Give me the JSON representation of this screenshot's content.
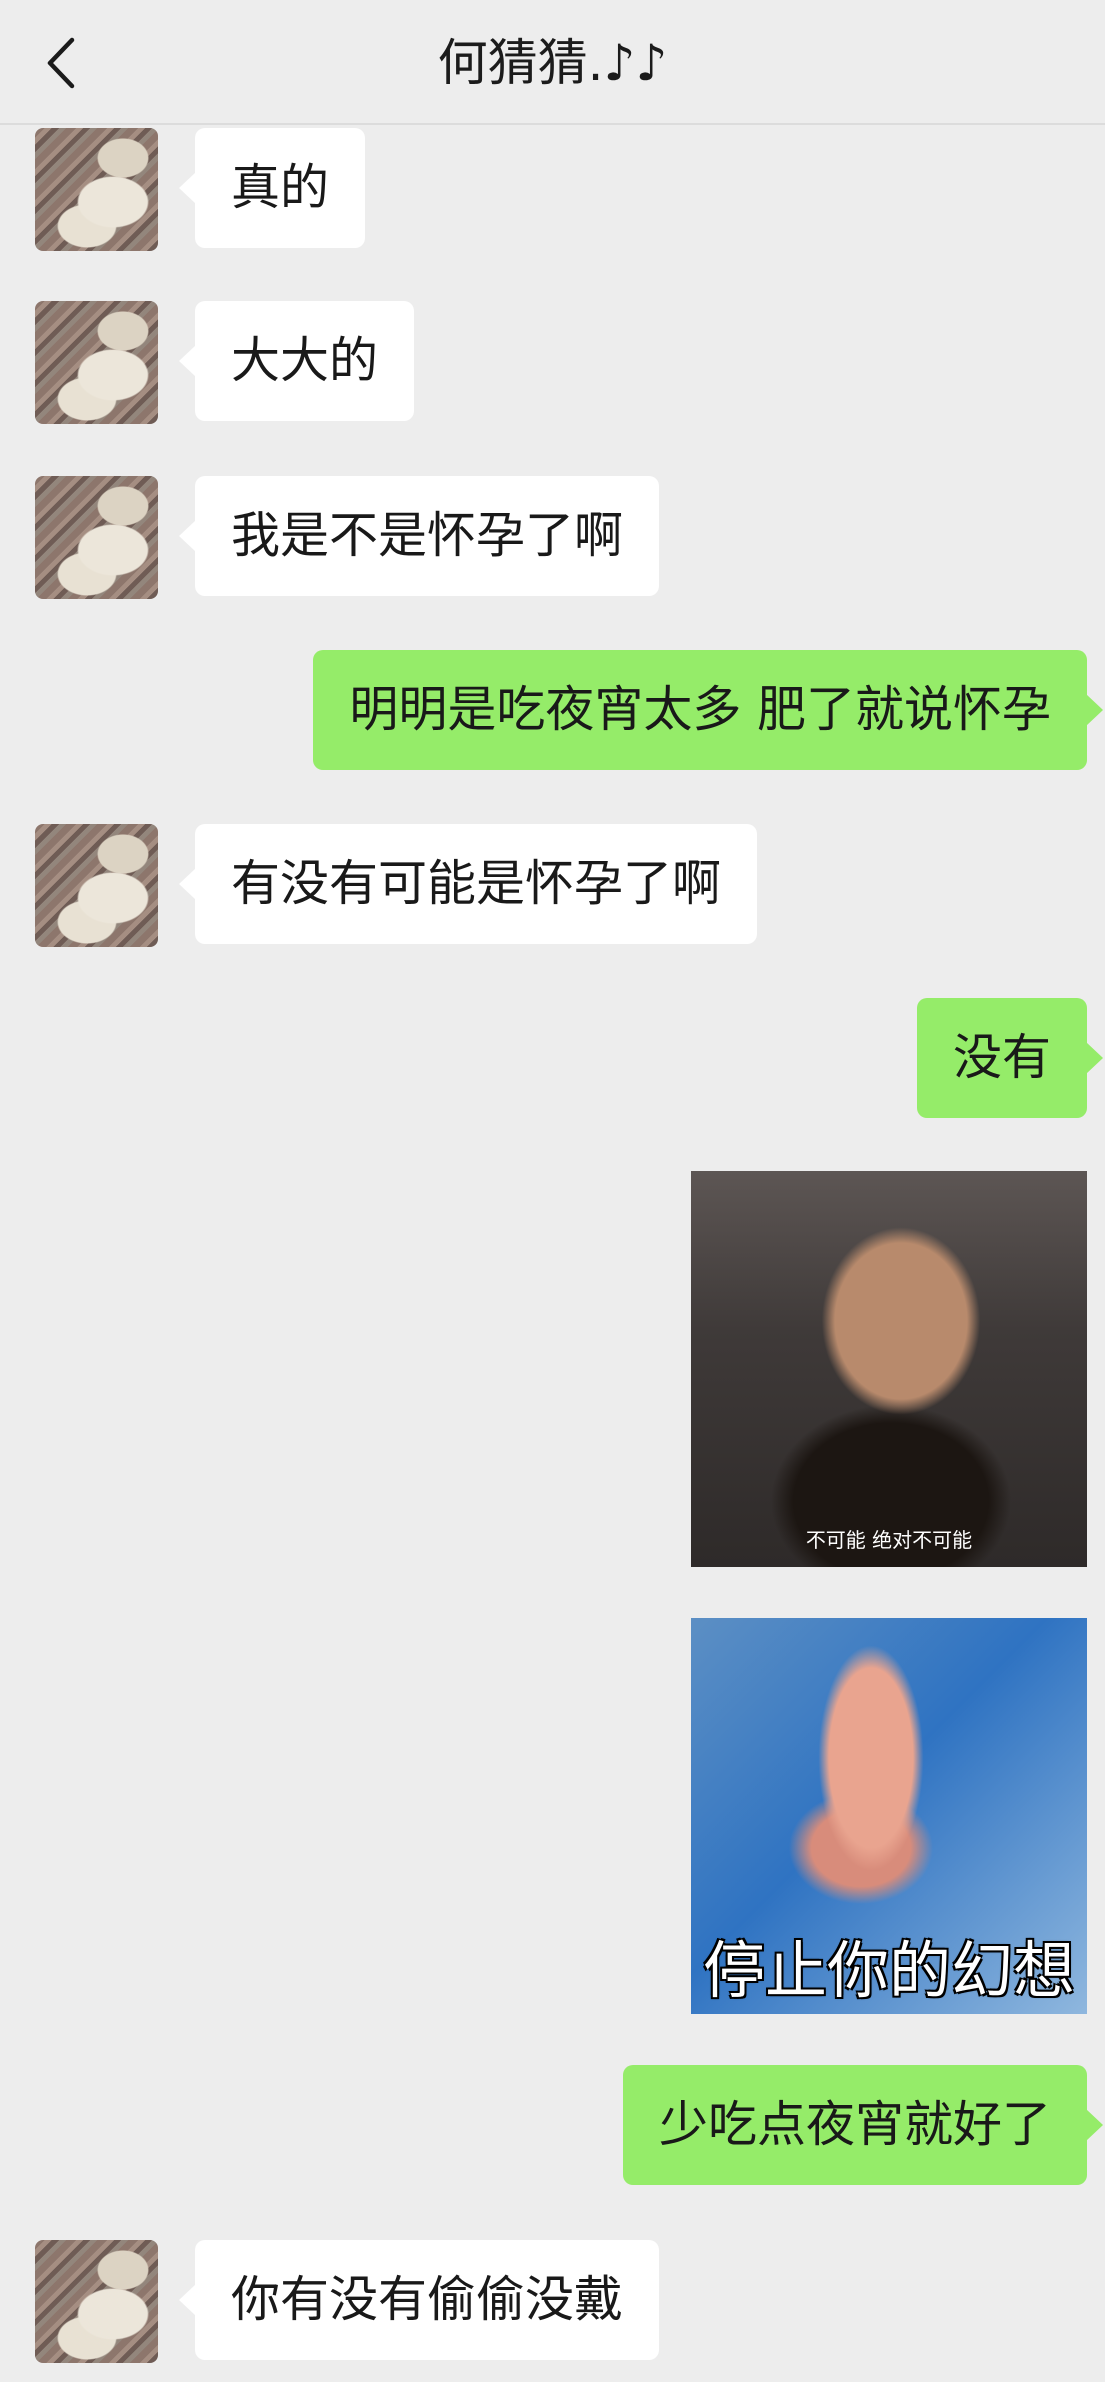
{
  "header": {
    "title": "何猜猜.♪♪"
  },
  "messages": [
    {
      "side": "in",
      "text": "真的"
    },
    {
      "side": "in",
      "text": "大大的"
    },
    {
      "side": "in",
      "text": "我是不是怀孕了啊"
    },
    {
      "side": "out",
      "text": "明明是吃夜宵太多 肥了就说怀孕"
    },
    {
      "side": "in",
      "text": "有没有可能是怀孕了啊"
    },
    {
      "side": "out",
      "text": "没有"
    },
    {
      "side": "out",
      "type": "sticker",
      "caption": "不可能 绝对不可能"
    },
    {
      "side": "out",
      "type": "sticker",
      "caption": "停止你的幻想"
    },
    {
      "side": "out",
      "text": "少吃点夜宵就好了"
    },
    {
      "side": "in",
      "text": "你有没有偷偷没戴"
    }
  ]
}
